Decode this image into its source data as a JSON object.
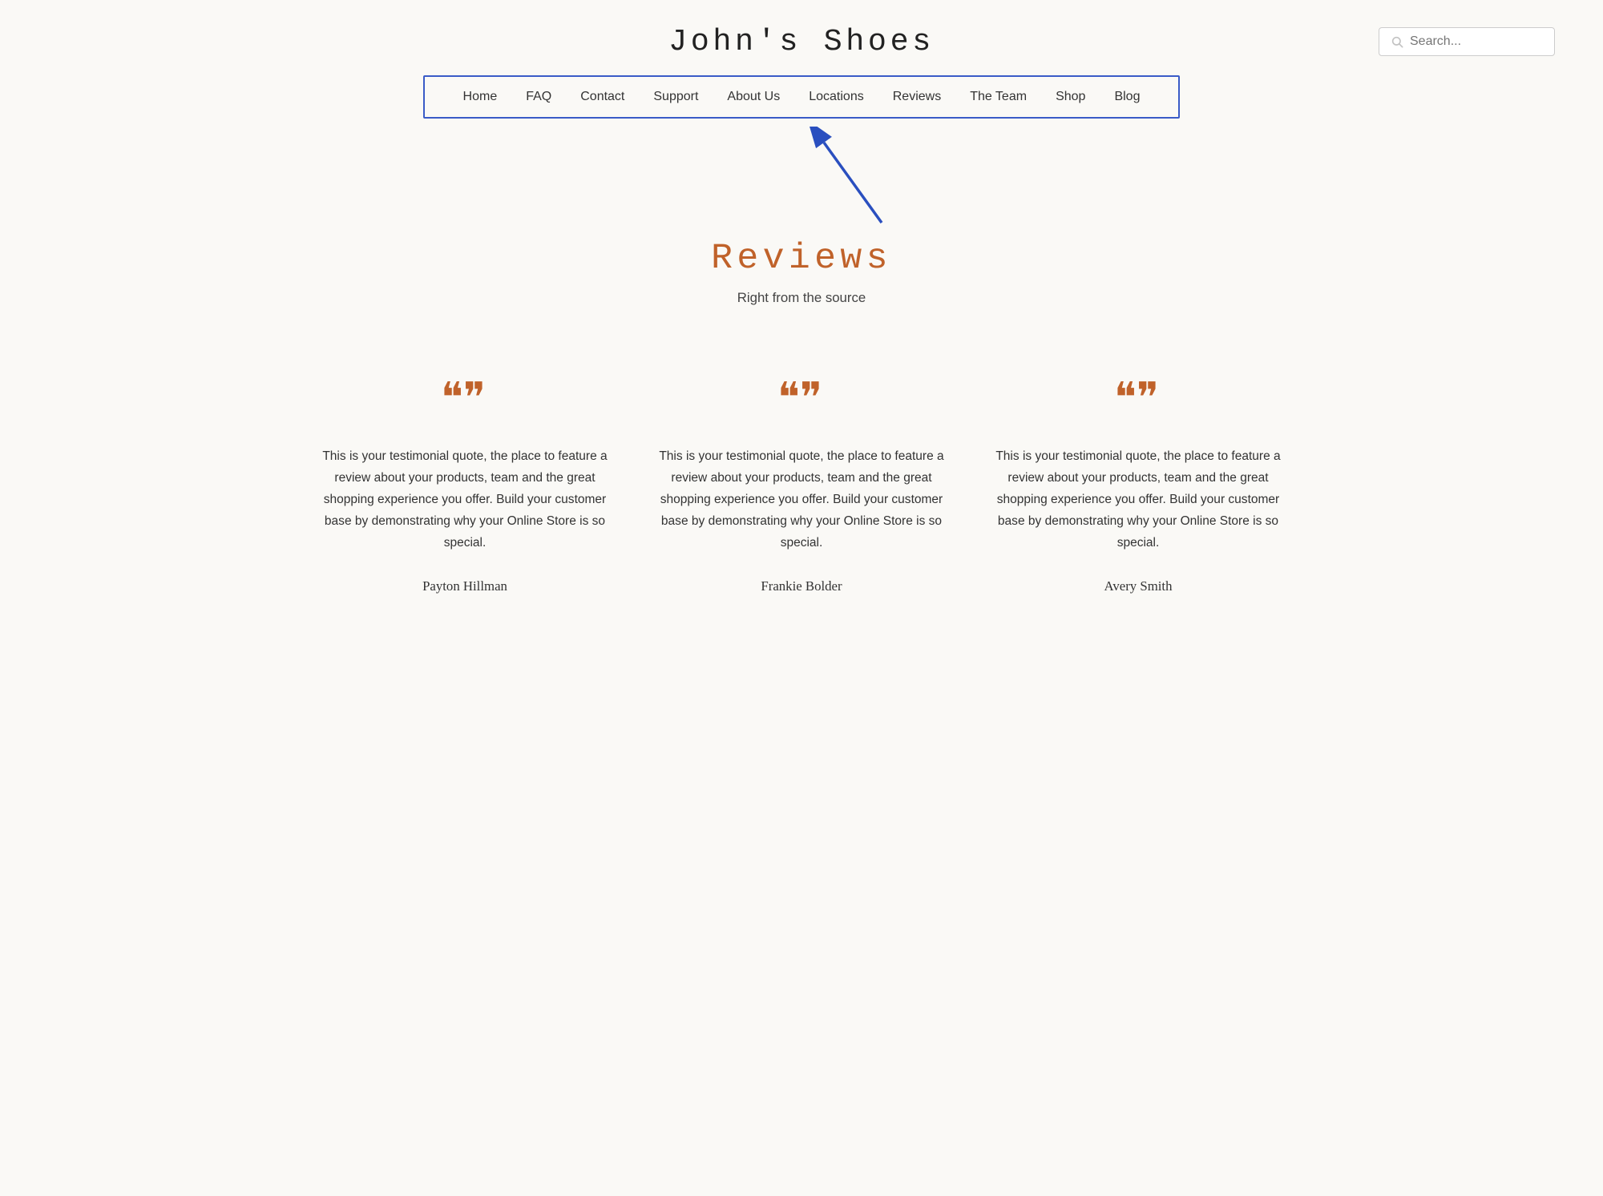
{
  "header": {
    "site_title": "John's Shoes",
    "search_placeholder": "Search..."
  },
  "nav": {
    "items": [
      {
        "label": "Home",
        "id": "home"
      },
      {
        "label": "FAQ",
        "id": "faq"
      },
      {
        "label": "Contact",
        "id": "contact"
      },
      {
        "label": "Support",
        "id": "support"
      },
      {
        "label": "About Us",
        "id": "about"
      },
      {
        "label": "Locations",
        "id": "locations"
      },
      {
        "label": "Reviews",
        "id": "reviews"
      },
      {
        "label": "The Team",
        "id": "team"
      },
      {
        "label": "Shop",
        "id": "shop"
      },
      {
        "label": "Blog",
        "id": "blog"
      }
    ]
  },
  "reviews_section": {
    "heading": "Reviews",
    "subtitle": "Right from the source"
  },
  "testimonials": [
    {
      "quote_icon": "❞",
      "text": "This is your testimonial quote, the place to feature a review about your products, team and the great shopping experience you offer. Build your customer base by demonstrating why your Online Store is so special.",
      "reviewer": "Payton Hillman"
    },
    {
      "quote_icon": "❞",
      "text": "This is your testimonial quote, the place to feature a review about your products, team and the great shopping experience you offer. Build your customer base by demonstrating why your Online Store is so special.",
      "reviewer": "Frankie Bolder"
    },
    {
      "quote_icon": "❞",
      "text": "This is your testimonial quote, the place to feature a review about your products, team and the great shopping experience you offer. Build your customer base by demonstrating why your Online Store is so special.",
      "reviewer": "Avery Smith"
    }
  ],
  "colors": {
    "accent": "#c0622a",
    "nav_border": "#3a5bc7",
    "arrow": "#2a4fbf"
  }
}
